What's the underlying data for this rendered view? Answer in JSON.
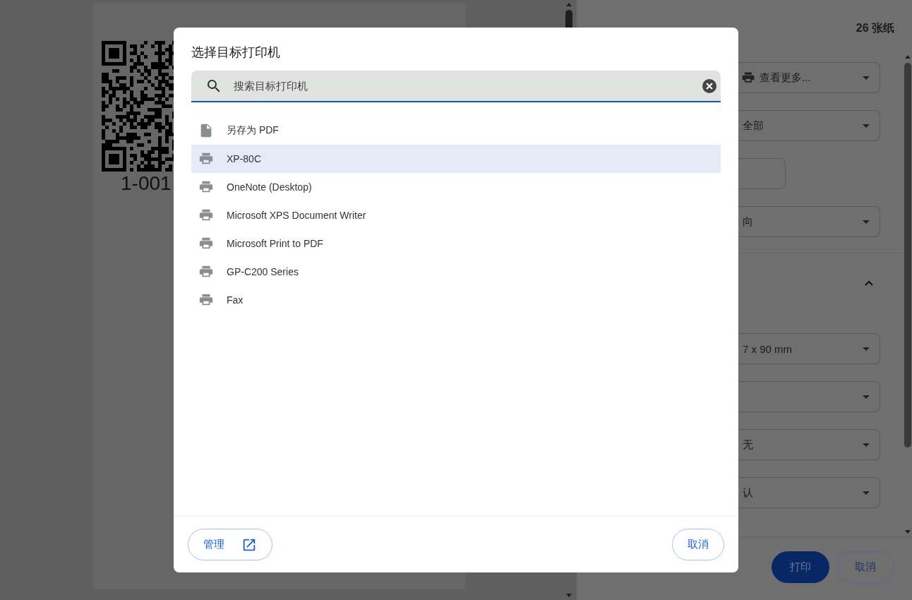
{
  "preview": {
    "label": "1-001"
  },
  "print_panel": {
    "sheet_count": "26 张纸",
    "settings": [
      {
        "kind": "destination",
        "value": "查看更多..."
      },
      {
        "kind": "select",
        "value": "全部"
      },
      {
        "kind": "input"
      },
      {
        "kind": "select",
        "value": "向"
      },
      {
        "kind": "section",
        "expanded": true
      },
      {
        "kind": "select",
        "value": "7 x 90 mm"
      },
      {
        "kind": "select"
      },
      {
        "kind": "select",
        "value": "无"
      },
      {
        "kind": "select",
        "value": "认"
      }
    ],
    "buttons": [
      {
        "label": "打印",
        "kind": "primary"
      },
      {
        "label": "取消",
        "kind": "outline"
      }
    ]
  },
  "dialog": {
    "title": "选择目标打印机",
    "search": {
      "placeholder": "搜索目标打印机"
    },
    "destinations": [
      {
        "name": "另存为 PDF",
        "kind": "file",
        "selected": false
      },
      {
        "name": "XP-80C",
        "kind": "printer",
        "selected": true
      },
      {
        "name": "OneNote (Desktop)",
        "kind": "printer",
        "selected": false
      },
      {
        "name": "Microsoft XPS Document Writer",
        "kind": "printer",
        "selected": false
      },
      {
        "name": "Microsoft Print to PDF",
        "kind": "printer",
        "selected": false
      },
      {
        "name": "GP-C200 Series",
        "kind": "printer",
        "selected": false
      },
      {
        "name": "Fax",
        "kind": "printer",
        "selected": false
      }
    ],
    "manage_button": "管理",
    "cancel_button": "取消"
  }
}
